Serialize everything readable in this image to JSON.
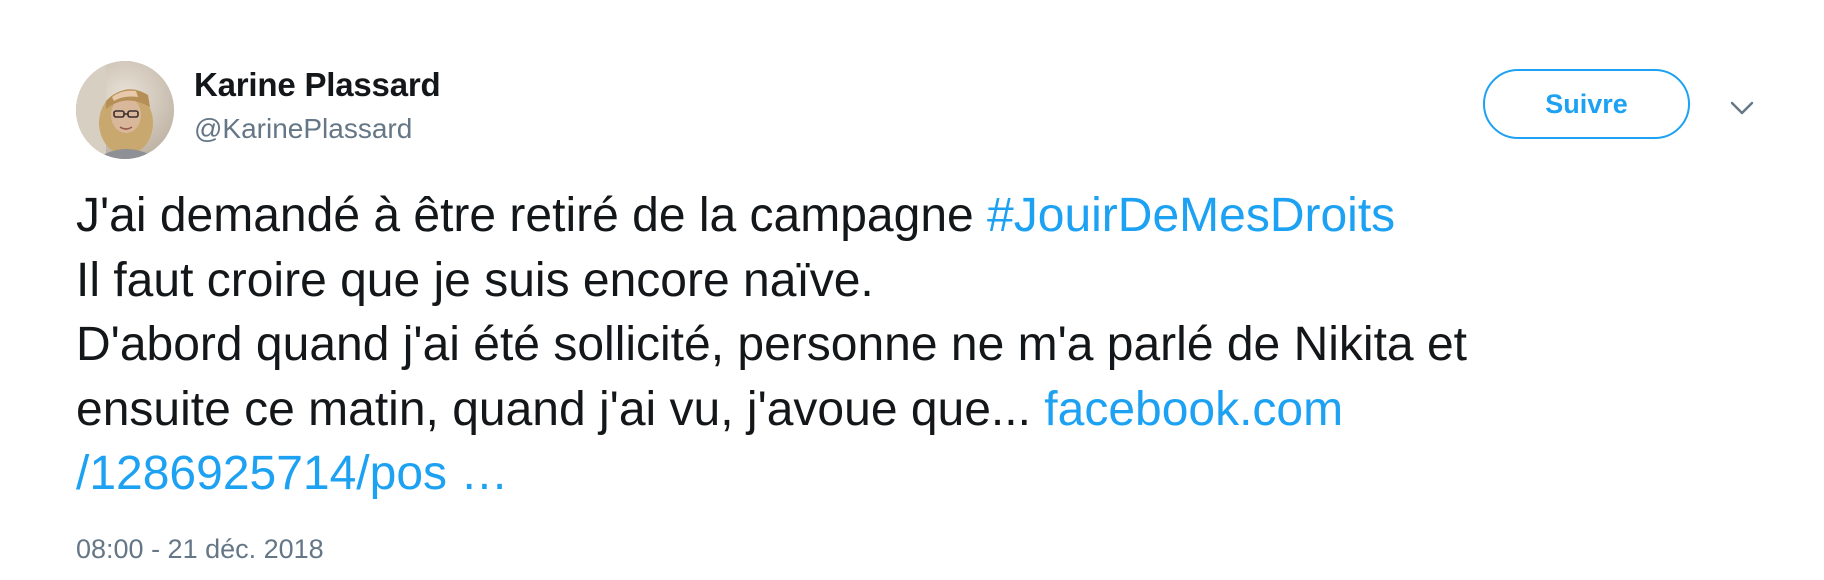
{
  "author": {
    "name": "Karine Plassard",
    "handle": "@KarinePlassard"
  },
  "actions": {
    "follow_label": "Suivre"
  },
  "tweet": {
    "line1_text": "J'ai demandé à être retiré de la campagne ",
    "hashtag": "#JouirDeMesDroits",
    "line2": "Il faut croire que je suis encore naïve.",
    "line3": "D'abord quand j'ai été sollicité, personne ne m'a parlé de Nikita et",
    "line4_text": "ensuite ce matin, quand j'ai vu, j'avoue que... ",
    "link_part1": "facebook.com",
    "link_part2": "/1286925714/pos …",
    "timestamp": "08:00 - 21 déc. 2018"
  },
  "colors": {
    "link": "#1da1f2",
    "text": "#14171a",
    "secondary": "#657786"
  },
  "icons": {
    "avatar": "profile-photo",
    "menu": "chevron-down-icon"
  }
}
